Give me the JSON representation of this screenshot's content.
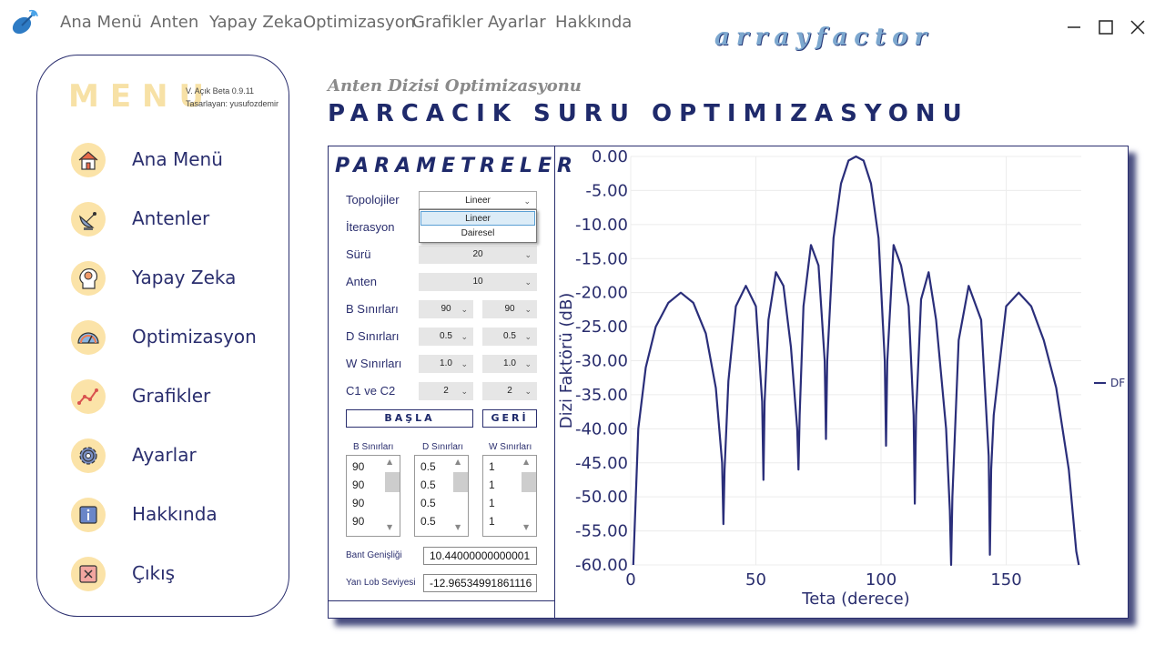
{
  "topbar": {
    "menu": [
      "Ana Menü",
      "Anten",
      "Yapay Zeka",
      "Optimizasyon",
      "Grafikler",
      "Ayarlar",
      "Hakkında"
    ],
    "brand": "arrayfactor",
    "window_controls": [
      "minimize-icon",
      "maximize-icon",
      "close-icon"
    ]
  },
  "sidebar": {
    "title": "MENU",
    "version": "V. Açık Beta 0.9.11",
    "author": "Tasarlayan: yusufozdemir",
    "items": [
      {
        "label": "Ana Menü",
        "icon": "home-icon"
      },
      {
        "label": "Antenler",
        "icon": "satellite-dish-icon"
      },
      {
        "label": "Yapay Zeka",
        "icon": "ai-brain-icon"
      },
      {
        "label": "Optimizasyon",
        "icon": "gauge-icon"
      },
      {
        "label": "Grafikler",
        "icon": "line-graph-icon"
      },
      {
        "label": "Ayarlar",
        "icon": "gear-icon"
      },
      {
        "label": "Hakkında",
        "icon": "info-icon"
      },
      {
        "label": "Çıkış",
        "icon": "exit-icon"
      }
    ]
  },
  "header": {
    "subtitle": "Anten Dizisi Optimizasyonu",
    "title": "PARCACIK SURU OPTIMIZASYONU"
  },
  "params": {
    "title": "PARAMETRELER",
    "labels": {
      "topology": "Topolojiler",
      "iteration": "İterasyon",
      "swarm": "Sürü",
      "antenna": "Anten",
      "b_bounds": "B Sınırları",
      "d_bounds": "D Sınırları",
      "w_bounds": "W Sınırları",
      "c1c2": "C1 ve C2"
    },
    "values": {
      "topology": "Lineer",
      "swarm": "20",
      "antenna": "10",
      "b_min": "90",
      "b_max": "90",
      "d_min": "0.5",
      "d_max": "0.5",
      "w_min": "1.0",
      "w_max": "1.0",
      "c1": "2",
      "c2": "2"
    },
    "dropdown_options": [
      "Lineer",
      "Dairesel"
    ],
    "start_button": "BAŞLA",
    "back_button": "GERİ",
    "lists": {
      "b_header": "B Sınırları",
      "d_header": "D Sınırları",
      "w_header": "W Sınırları",
      "b_items": [
        "90",
        "90",
        "90",
        "90"
      ],
      "d_items": [
        "0.5",
        "0.5",
        "0.5",
        "0.5"
      ],
      "w_items": [
        "1",
        "1",
        "1",
        "1"
      ]
    },
    "outputs": {
      "bandwidth_label": "Bant Genişliği",
      "bandwidth_value": "10.44000000000001",
      "sidelobe_label": "Yan Lob Seviyesi",
      "sidelobe_value": "-12.96534991861116"
    }
  },
  "chart_data": {
    "type": "line",
    "xlabel": "Teta (derece)",
    "ylabel": "Dizi Faktörü (dB)",
    "xlim": [
      0,
      180
    ],
    "ylim": [
      -60,
      0
    ],
    "xticks": [
      "0",
      "50",
      "100",
      "150"
    ],
    "yticks": [
      "0.00",
      "-5.00",
      "-10.00",
      "-15.00",
      "-20.00",
      "-25.00",
      "-30.00",
      "-35.00",
      "-40.00",
      "-45.00",
      "-50.00",
      "-55.00",
      "-60.00"
    ],
    "grid": true,
    "legend": "right",
    "color": "#2a2e7a",
    "series": [
      {
        "name": "DF",
        "x": [
          1,
          3,
          6,
          10,
          15,
          20,
          25,
          30,
          34,
          36.5,
          37,
          37.5,
          39,
          42,
          46,
          50,
          52.5,
          53,
          53.5,
          55,
          58,
          61,
          64,
          66.5,
          67,
          67.5,
          69,
          72,
          75,
          77.5,
          78,
          78.5,
          81,
          84,
          87,
          90,
          93,
          96,
          99,
          101.5,
          102,
          102.5,
          105,
          108,
          111,
          113,
          113.5,
          114,
          116,
          119,
          122,
          126,
          127.5,
          128,
          128.5,
          131,
          135,
          140,
          143,
          143.5,
          144,
          145,
          150,
          155,
          160,
          165,
          170,
          175,
          178,
          179
        ],
        "y": [
          -60,
          -40,
          -31,
          -25,
          -21.5,
          -20,
          -21.5,
          -26,
          -34,
          -45,
          -54,
          -46,
          -33,
          -22,
          -19,
          -22,
          -36,
          -47.5,
          -36,
          -24,
          -17,
          -19,
          -28,
          -40,
          -46,
          -38,
          -22,
          -13,
          -16,
          -30,
          -41.5,
          -30,
          -12,
          -4,
          -0.6,
          0,
          -0.6,
          -4,
          -12,
          -30,
          -42.5,
          -30,
          -13,
          -16,
          -22,
          -38,
          -51,
          -38,
          -21,
          -17,
          -24,
          -40,
          -52,
          -60,
          -50,
          -27,
          -19,
          -24,
          -44,
          -58.5,
          -46,
          -38,
          -22,
          -20,
          -22,
          -27,
          -34,
          -46,
          -58,
          -60
        ]
      }
    ]
  }
}
